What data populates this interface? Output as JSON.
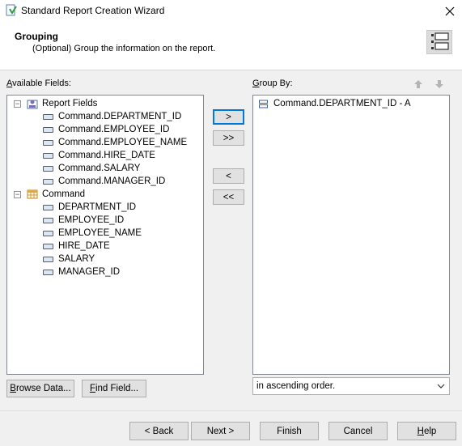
{
  "window": {
    "title": "Standard Report Creation Wizard",
    "close_icon": "close-icon"
  },
  "header": {
    "title": "Grouping",
    "subtitle": "(Optional) Group the information on the report.",
    "icon": "grouping-icon"
  },
  "available": {
    "label_prefix": "",
    "label_underlined": "A",
    "label_rest": "vailable Fields:",
    "tree": [
      {
        "label": "Report Fields",
        "icon": "report-fields-icon",
        "expanded": true,
        "children": [
          "Command.DEPARTMENT_ID",
          "Command.EMPLOYEE_ID",
          "Command.EMPLOYEE_NAME",
          "Command.HIRE_DATE",
          "Command.SALARY",
          "Command.MANAGER_ID"
        ]
      },
      {
        "label": "Command",
        "icon": "table-icon",
        "expanded": true,
        "children": [
          "DEPARTMENT_ID",
          "EMPLOYEE_ID",
          "EMPLOYEE_NAME",
          "HIRE_DATE",
          "SALARY",
          "MANAGER_ID"
        ]
      }
    ],
    "expander_glyph": "−"
  },
  "transfer": {
    "add": ">",
    "add_all": ">>",
    "remove": "<",
    "remove_all": "<<"
  },
  "group_by": {
    "label_underlined": "G",
    "label_rest": "roup By:",
    "items": [
      "Command.DEPARTMENT_ID - A"
    ],
    "order_value": "in ascending order."
  },
  "buttons": {
    "browse_data_u": "B",
    "browse_data_rest": "rowse Data...",
    "find_field_u": "F",
    "find_field_rest": "ind Field...",
    "back": "< Back",
    "next": "Next >",
    "finish": "Finish",
    "cancel": "Cancel",
    "help_u": "H",
    "help_rest": "elp"
  }
}
